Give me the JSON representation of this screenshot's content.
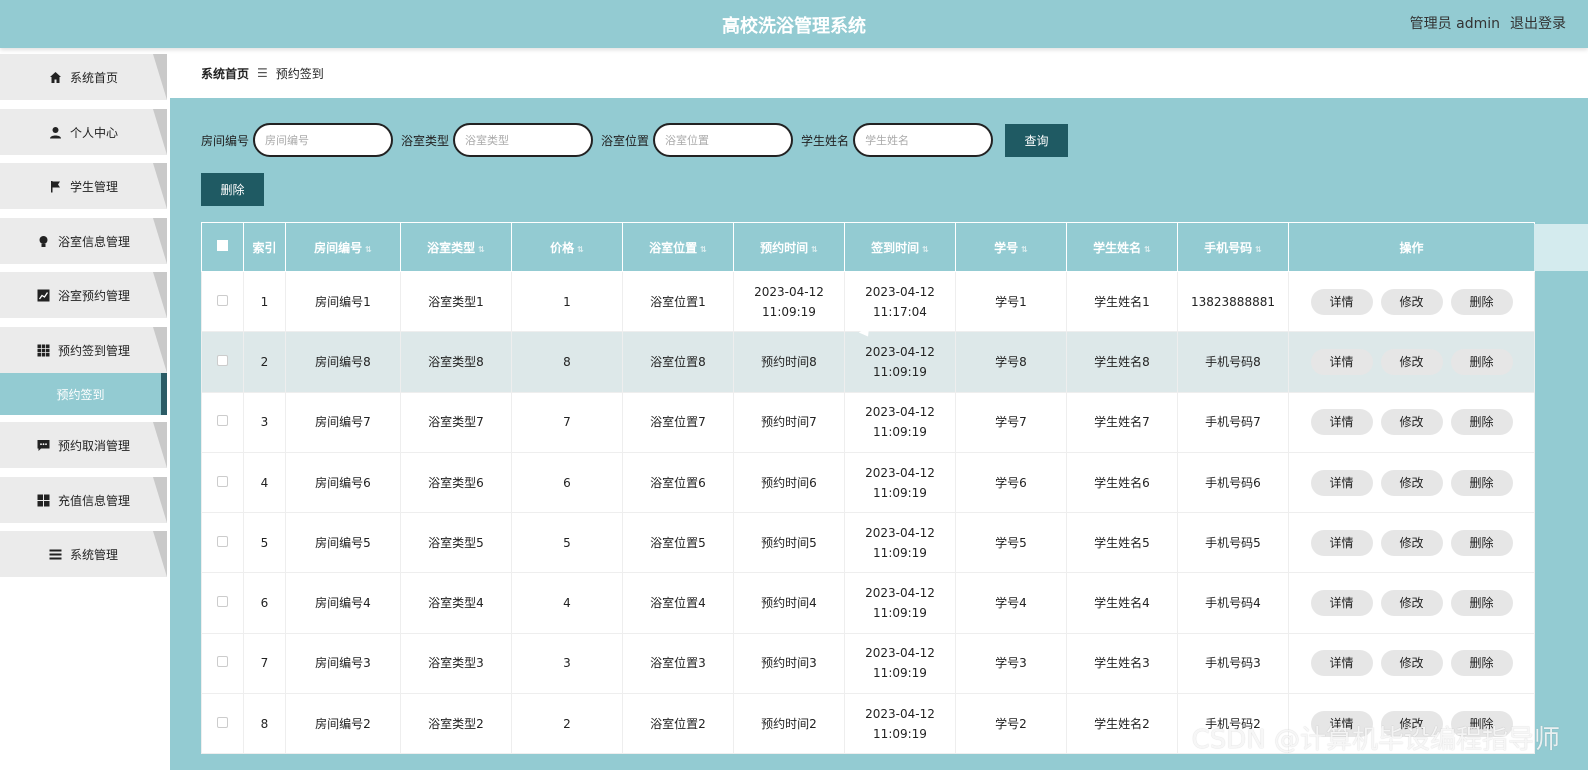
{
  "header": {
    "title": "高校洗浴管理系统",
    "user_label": "管理员 admin",
    "logout_label": "退出登录"
  },
  "sidebar": {
    "items": [
      {
        "label": "系统首页",
        "icon": "home-icon"
      },
      {
        "label": "个人中心",
        "icon": "user-icon"
      },
      {
        "label": "学生管理",
        "icon": "flag-icon"
      },
      {
        "label": "浴室信息管理",
        "icon": "bulb-icon"
      },
      {
        "label": "浴室预约管理",
        "icon": "chart-icon"
      },
      {
        "label": "预约签到管理",
        "icon": "grid-icon"
      },
      {
        "label": "预约取消管理",
        "icon": "chat-icon"
      },
      {
        "label": "充值信息管理",
        "icon": "apps-icon"
      },
      {
        "label": "系统管理",
        "icon": "menu-icon"
      }
    ],
    "active_sub": "预约签到"
  },
  "breadcrumb": {
    "home": "系统首页",
    "separator": "☰",
    "current": "预约签到"
  },
  "search": {
    "fields": [
      {
        "label": "房间编号",
        "placeholder": "房间编号"
      },
      {
        "label": "浴室类型",
        "placeholder": "浴室类型"
      },
      {
        "label": "浴室位置",
        "placeholder": "浴室位置"
      },
      {
        "label": "学生姓名",
        "placeholder": "学生姓名"
      }
    ],
    "query_label": "查询"
  },
  "toolbar": {
    "delete_label": "删除"
  },
  "table": {
    "headers": [
      "索引",
      "房间编号",
      "浴室类型",
      "价格",
      "浴室位置",
      "预约时间",
      "签到时间",
      "学号",
      "学生姓名",
      "手机号码",
      "操作"
    ],
    "sort_icon": "⇅",
    "actions": {
      "detail": "详情",
      "edit": "修改",
      "delete": "删除"
    },
    "rows": [
      {
        "index": "1",
        "room": "房间编号1",
        "type": "浴室类型1",
        "price": "1",
        "location": "浴室位置1",
        "reserve_time": "2023-04-12 11:09:19",
        "signin_time": "2023-04-12 11:17:04",
        "student_no": "学号1",
        "student_name": "学生姓名1",
        "phone": "13823888881"
      },
      {
        "index": "2",
        "room": "房间编号8",
        "type": "浴室类型8",
        "price": "8",
        "location": "浴室位置8",
        "reserve_time": "预约时间8",
        "signin_time": "2023-04-12 11:09:19",
        "student_no": "学号8",
        "student_name": "学生姓名8",
        "phone": "手机号码8"
      },
      {
        "index": "3",
        "room": "房间编号7",
        "type": "浴室类型7",
        "price": "7",
        "location": "浴室位置7",
        "reserve_time": "预约时间7",
        "signin_time": "2023-04-12 11:09:19",
        "student_no": "学号7",
        "student_name": "学生姓名7",
        "phone": "手机号码7"
      },
      {
        "index": "4",
        "room": "房间编号6",
        "type": "浴室类型6",
        "price": "6",
        "location": "浴室位置6",
        "reserve_time": "预约时间6",
        "signin_time": "2023-04-12 11:09:19",
        "student_no": "学号6",
        "student_name": "学生姓名6",
        "phone": "手机号码6"
      },
      {
        "index": "5",
        "room": "房间编号5",
        "type": "浴室类型5",
        "price": "5",
        "location": "浴室位置5",
        "reserve_time": "预约时间5",
        "signin_time": "2023-04-12 11:09:19",
        "student_no": "学号5",
        "student_name": "学生姓名5",
        "phone": "手机号码5"
      },
      {
        "index": "6",
        "room": "房间编号4",
        "type": "浴室类型4",
        "price": "4",
        "location": "浴室位置4",
        "reserve_time": "预约时间4",
        "signin_time": "2023-04-12 11:09:19",
        "student_no": "学号4",
        "student_name": "学生姓名4",
        "phone": "手机号码4"
      },
      {
        "index": "7",
        "room": "房间编号3",
        "type": "浴室类型3",
        "price": "3",
        "location": "浴室位置3",
        "reserve_time": "预约时间3",
        "signin_time": "2023-04-12 11:09:19",
        "student_no": "学号3",
        "student_name": "学生姓名3",
        "phone": "手机号码3"
      },
      {
        "index": "8",
        "room": "房间编号2",
        "type": "浴室类型2",
        "price": "2",
        "location": "浴室位置2",
        "reserve_time": "预约时间2",
        "signin_time": "2023-04-12 11:09:19",
        "student_no": "学号2",
        "student_name": "学生姓名2",
        "phone": "手机号码2"
      }
    ]
  },
  "watermark": "CSDN @计算机毕设编程指导师",
  "colors": {
    "primary": "#93cbd2",
    "dark": "#1f5a63",
    "row_alt": "#dde8e9"
  }
}
